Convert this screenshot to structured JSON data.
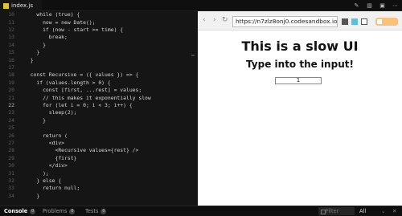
{
  "file_tab": {
    "label": "index.js"
  },
  "editor": {
    "lines": [
      {
        "n": "10",
        "text": "    while (true) {",
        "cur": false
      },
      {
        "n": "11",
        "text": "      now = new Date();",
        "cur": false
      },
      {
        "n": "12",
        "text": "      if (now - start >= time) {",
        "cur": false
      },
      {
        "n": "13",
        "text": "        break;",
        "cur": false
      },
      {
        "n": "14",
        "text": "      }",
        "cur": false
      },
      {
        "n": "15",
        "text": "    }",
        "cur": false
      },
      {
        "n": "16",
        "text": "  }",
        "cur": false
      },
      {
        "n": "17",
        "text": "",
        "cur": false
      },
      {
        "n": "18",
        "text": "  const Recursive = ({ values }) => {",
        "cur": false
      },
      {
        "n": "19",
        "text": "    if (values.length > 0) {",
        "cur": false
      },
      {
        "n": "20",
        "text": "      const [first, ...rest] = values;",
        "cur": false
      },
      {
        "n": "21",
        "text": "      // this makes it exponentially slow",
        "cur": false
      },
      {
        "n": "22",
        "text": "      for (let i = 0; i < 3; i++) {",
        "cur": true
      },
      {
        "n": "23",
        "text": "        sleep(2);",
        "cur": false
      },
      {
        "n": "24",
        "text": "      }",
        "cur": false
      },
      {
        "n": "25",
        "text": "",
        "cur": false
      },
      {
        "n": "26",
        "text": "      return (",
        "cur": false
      },
      {
        "n": "27",
        "text": "        <div>",
        "cur": false
      },
      {
        "n": "28",
        "text": "          <Recursive values={rest} />",
        "cur": false
      },
      {
        "n": "29",
        "text": "          {first}",
        "cur": false
      },
      {
        "n": "30",
        "text": "        </div>",
        "cur": false
      },
      {
        "n": "31",
        "text": "      );",
        "cur": false
      },
      {
        "n": "32",
        "text": "    } else {",
        "cur": false
      },
      {
        "n": "33",
        "text": "      return null;",
        "cur": false
      },
      {
        "n": "34",
        "text": "    }",
        "cur": false
      }
    ]
  },
  "browser": {
    "url": "https://n7zlz8onj0.codesandbox.io/",
    "heading": "This is a slow UI",
    "subheading": "Type into the input!",
    "input_value": "1"
  },
  "bottom": {
    "tabs": [
      {
        "label": "Console",
        "count": "0",
        "active": true
      },
      {
        "label": "Problems",
        "count": "0",
        "active": false
      },
      {
        "label": "Tests",
        "count": "0",
        "active": false
      }
    ],
    "filter_placeholder": "Filter",
    "level": "All"
  },
  "colors": {
    "accent_pill": "#f9c27a",
    "js_icon": "#d9c43a"
  }
}
